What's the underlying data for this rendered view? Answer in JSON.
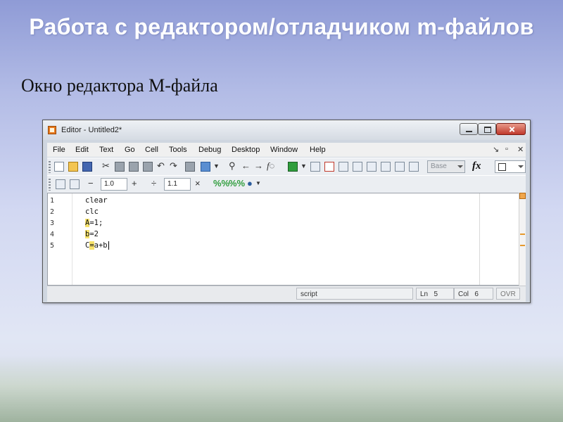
{
  "slide": {
    "title": "Работа с редактором/отладчиком m-файлов",
    "subtitle": "Окно редактора M-файла"
  },
  "window": {
    "title": "Editor - Untitled2*",
    "minimize_label": "",
    "maximize_label": "",
    "close_label": ""
  },
  "menu": {
    "items": [
      "File",
      "Edit",
      "Text",
      "Go",
      "Cell",
      "Tools",
      "Debug",
      "Desktop",
      "Window",
      "Help"
    ],
    "right_icons": [
      "↘",
      "▫",
      "✕"
    ]
  },
  "toolbar": {
    "stack_combo": "Base",
    "fx_label": "fx"
  },
  "cell_toolbar": {
    "minus": "−",
    "value1": "1.0",
    "plus": "+",
    "divide": "÷",
    "value2": "1.1",
    "times": "×"
  },
  "editor": {
    "line_numbers": [
      "1",
      "2",
      "3",
      "4",
      "5"
    ],
    "lines": [
      {
        "pre": "clear",
        "hl": "",
        "post": ""
      },
      {
        "pre": "clc",
        "hl": "",
        "post": ""
      },
      {
        "pre": "",
        "hl": "A",
        "post": "=1;"
      },
      {
        "pre": "",
        "hl": "b",
        "post": "=2"
      },
      {
        "pre": "C",
        "hl": "=",
        "post": "a+b"
      }
    ]
  },
  "status": {
    "mode": "script",
    "ln_label": "Ln",
    "ln_value": "5",
    "col_label": "Col",
    "col_value": "6",
    "ovr": "OVR"
  },
  "colors": {
    "highlight": "#f7e26b",
    "close_button": "#c0392b",
    "scroll_marker": "#e59a2f"
  }
}
